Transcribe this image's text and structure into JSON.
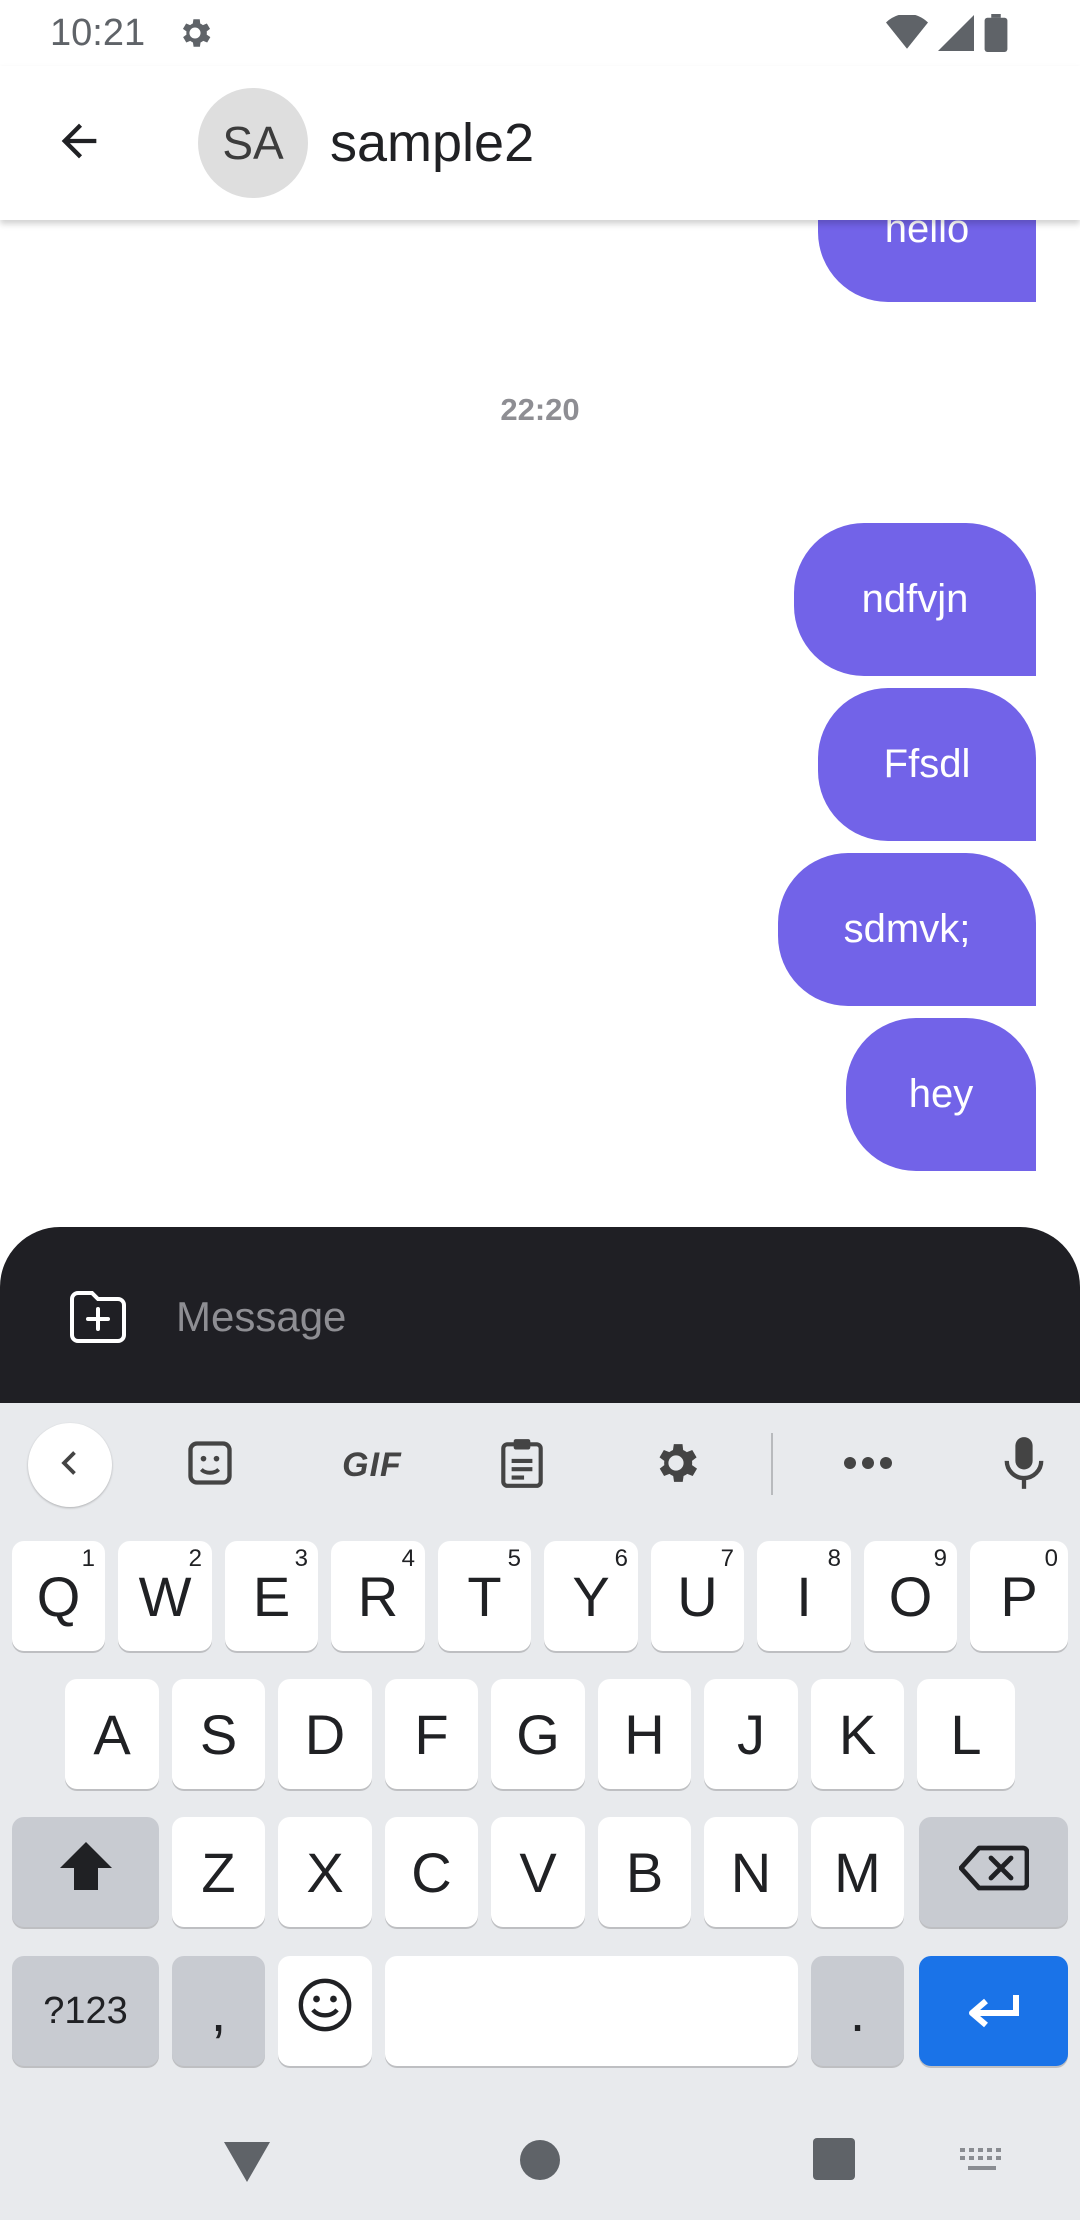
{
  "status_bar": {
    "time": "10:21",
    "icons": [
      "gear-icon",
      "wifi-icon",
      "cell-signal-icon",
      "battery-icon"
    ]
  },
  "header": {
    "back_icon": "arrow-left-icon",
    "avatar_initials": "SA",
    "contact_name": "sample2"
  },
  "chat": {
    "messages_before": [
      {
        "text": "hello",
        "sender": "me"
      }
    ],
    "time_separator": "22:20",
    "messages_after": [
      {
        "text": "ndfvjn",
        "sender": "me"
      },
      {
        "text": "Ffsdl",
        "sender": "me"
      },
      {
        "text": "sdmvk;",
        "sender": "me"
      },
      {
        "text": "hey",
        "sender": "me"
      }
    ],
    "bubble_color": "#7263e8"
  },
  "composer": {
    "attach_icon": "folder-plus-icon",
    "placeholder": "Message",
    "value": ""
  },
  "keyboard": {
    "toolbar": {
      "back_icon": "chevron-left-icon",
      "sticker_icon": "sticker-icon",
      "gif_label": "GIF",
      "clipboard_icon": "clipboard-icon",
      "settings_icon": "gear-icon",
      "more_icon": "more-horizontal-icon",
      "mic_icon": "microphone-icon"
    },
    "row1": [
      {
        "label": "Q",
        "hint": "1"
      },
      {
        "label": "W",
        "hint": "2"
      },
      {
        "label": "E",
        "hint": "3"
      },
      {
        "label": "R",
        "hint": "4"
      },
      {
        "label": "T",
        "hint": "5"
      },
      {
        "label": "Y",
        "hint": "6"
      },
      {
        "label": "U",
        "hint": "7"
      },
      {
        "label": "I",
        "hint": "8"
      },
      {
        "label": "O",
        "hint": "9"
      },
      {
        "label": "P",
        "hint": "0"
      }
    ],
    "row2": [
      "A",
      "S",
      "D",
      "F",
      "G",
      "H",
      "J",
      "K",
      "L"
    ],
    "row3": [
      "Z",
      "X",
      "C",
      "V",
      "B",
      "N",
      "M"
    ],
    "row4": {
      "symbols_label": "?123",
      "comma_label": ",",
      "period_label": ".",
      "space_label": ""
    },
    "enter_color": "#1a73e8"
  },
  "nav_bar": {
    "icons": [
      "back-triangle-icon",
      "home-circle-icon",
      "recents-square-icon",
      "keyboard-switch-icon"
    ]
  }
}
